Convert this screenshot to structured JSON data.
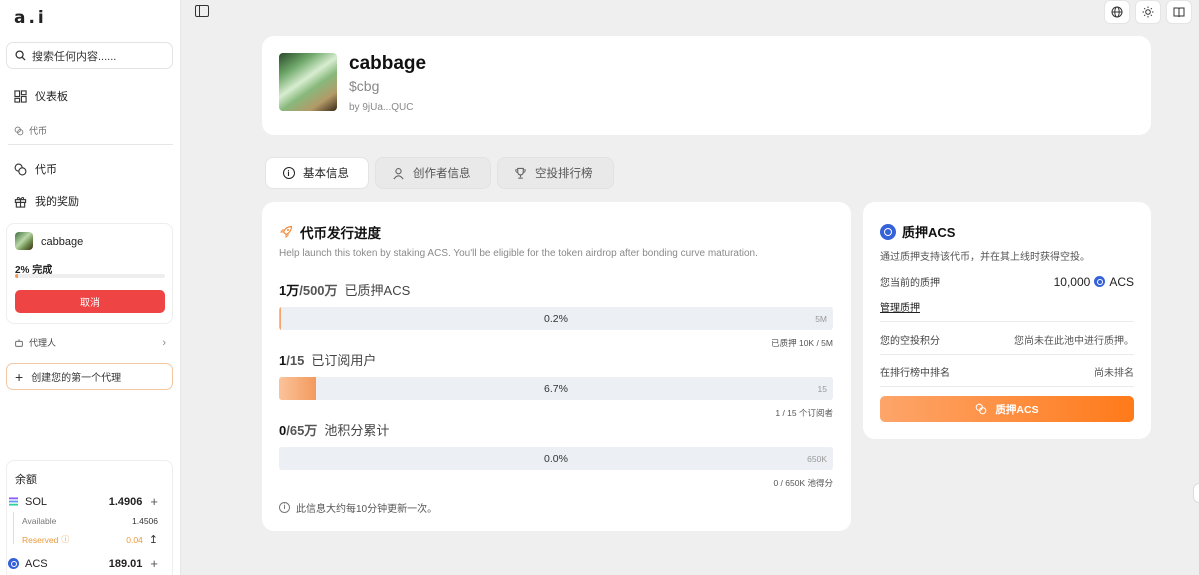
{
  "app": {
    "logo": "a.i"
  },
  "sidebar": {
    "search_placeholder": "搜索任何内容......",
    "dashboard": "仪表板",
    "section_tokens": "代币",
    "tokens": "代币",
    "rewards": "我的奖励",
    "token_card": {
      "name": "cabbage",
      "progress_label": "2% 完成",
      "progress": 0.02,
      "cancel": "取消"
    },
    "agents_label": "代理人",
    "create_agent": "创建您的第一个代理",
    "balance": {
      "title": "余额",
      "sol": {
        "symbol": "SOL",
        "amount": "1.4906",
        "available_label": "Available",
        "available": "1.4506",
        "reserved_label": "Reserved",
        "reserved": "0.04"
      },
      "acs": {
        "symbol": "ACS",
        "amount": "189.01"
      }
    }
  },
  "token": {
    "name": "cabbage",
    "symbol": "$cbg",
    "creator": "by 9jUa...QUC"
  },
  "tabs": [
    {
      "label": "基本信息",
      "active": true
    },
    {
      "label": "创作者信息",
      "active": false
    },
    {
      "label": "空投排行榜",
      "active": false
    }
  ],
  "launch": {
    "title": "代币发行进度",
    "description": "Help launch this token by staking ACS. You'll be eligible for the token airdrop after bonding curve maturation.",
    "metrics": [
      {
        "current": "1万",
        "total": "/500万",
        "label": "已质押ACS",
        "percent": "0.2%",
        "fill": 0.002,
        "cap": "5M",
        "note": "已质押 10K / 5M"
      },
      {
        "current": "1",
        "total": "/15",
        "label": "已订阅用户",
        "percent": "6.7%",
        "fill": 0.067,
        "cap": "15",
        "note": "1 / 15 个订阅者"
      },
      {
        "current": "0",
        "total": "/65万",
        "label": "池积分累计",
        "percent": "0.0%",
        "fill": 0,
        "cap": "650K",
        "note": "0 / 650K 池得分"
      }
    ],
    "footer": "此信息大约每10分钟更新一次。"
  },
  "stake": {
    "title": "质押ACS",
    "description": "通过质押支持该代币，并在其上线时获得空投。",
    "current_label": "您当前的质押",
    "current_value": "10,000",
    "current_unit": "ACS",
    "manage": "管理质押",
    "points_label": "您的空投积分",
    "points_value": "您尚未在此池中进行质押。",
    "rank_label": "在排行榜中排名",
    "rank_value": "尚未排名",
    "button": "质押ACS"
  },
  "colors": {
    "accent": "#ff7a1a",
    "danger": "#ee4444",
    "acs": "#3561d9"
  }
}
